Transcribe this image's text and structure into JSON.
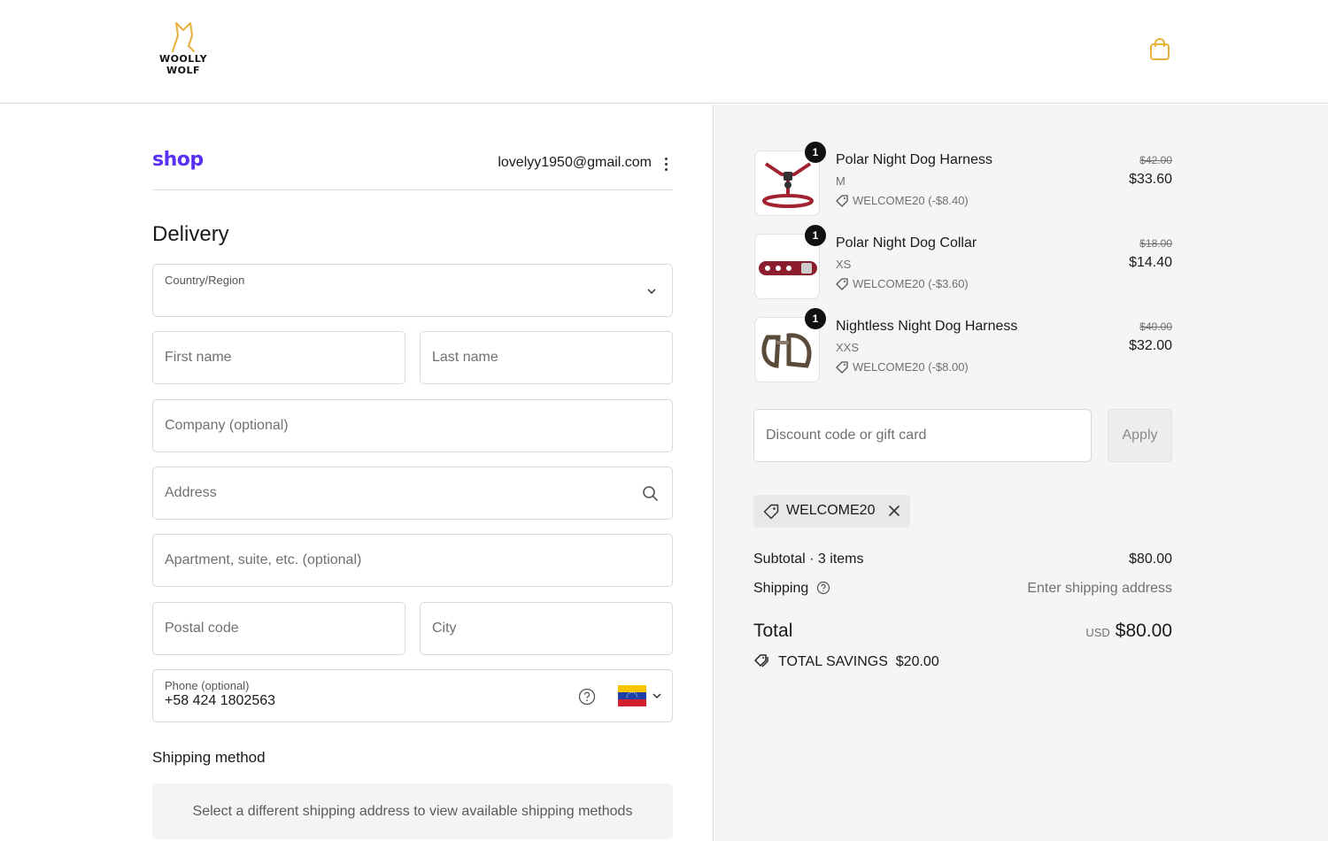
{
  "header": {
    "logo_line1": "WOOLLY",
    "logo_line2": "WOLF",
    "accent_color": "#e8b13c"
  },
  "shop_pay": {
    "logo_text": "shop",
    "email": "lovelyy1950@gmail.com",
    "brand_color": "#5a31f4"
  },
  "delivery": {
    "title": "Delivery",
    "country_label": "Country/Region",
    "first_name_placeholder": "First name",
    "last_name_placeholder": "Last name",
    "company_placeholder": "Company (optional)",
    "address_placeholder": "Address",
    "apartment_placeholder": "Apartment, suite, etc. (optional)",
    "postal_placeholder": "Postal code",
    "city_placeholder": "City",
    "phone_label": "Phone (optional)",
    "phone_value": "+58 424 1802563",
    "phone_country_flag": "venezuela-flag"
  },
  "shipping_method": {
    "title": "Shipping method",
    "notice": "Select a different shipping address to view available shipping methods"
  },
  "cart": {
    "items": [
      {
        "qty": "1",
        "name": "Polar Night Dog Harness",
        "variant": "M",
        "discount": "WELCOME20 (-$8.40)",
        "old_price": "$42.00",
        "price": "$33.60"
      },
      {
        "qty": "1",
        "name": "Polar Night Dog Collar",
        "variant": "XS",
        "discount": "WELCOME20 (-$3.60)",
        "old_price": "$18.00",
        "price": "$14.40"
      },
      {
        "qty": "1",
        "name": "Nightless Night Dog Harness",
        "variant": "XXS",
        "discount": "WELCOME20 (-$8.00)",
        "old_price": "$40.00",
        "price": "$32.00"
      }
    ],
    "discount_placeholder": "Discount code or gift card",
    "apply_label": "Apply",
    "applied_code": "WELCOME20",
    "subtotal_label": "Subtotal · 3 items",
    "subtotal_value": "$80.00",
    "shipping_label": "Shipping",
    "shipping_value": "Enter shipping address",
    "total_label": "Total",
    "total_currency": "USD",
    "total_value": "$80.00",
    "savings_label": "TOTAL SAVINGS",
    "savings_value": "$20.00"
  }
}
